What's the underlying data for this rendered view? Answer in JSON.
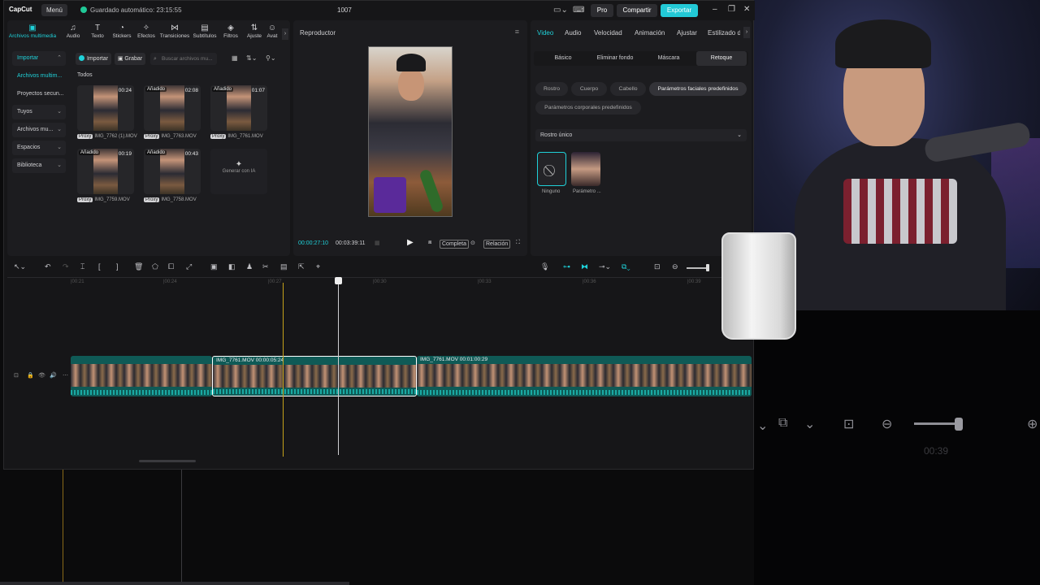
{
  "app": {
    "logo": "CapCut",
    "menu_label": "Menú",
    "autosave": "Guardado automático: 23:15:55",
    "project_title": "1007",
    "pro_label": "Pro",
    "share_label": "Compartir",
    "export_label": "Exportar"
  },
  "media": {
    "tabs": [
      {
        "label": "Archivos multimedia",
        "icon": "media-icon"
      },
      {
        "label": "Audio",
        "icon": "audio-icon"
      },
      {
        "label": "Texto",
        "icon": "text-icon"
      },
      {
        "label": "Stickers",
        "icon": "sticker-icon"
      },
      {
        "label": "Efectos",
        "icon": "effects-icon"
      },
      {
        "label": "Transiciones",
        "icon": "transitions-icon"
      },
      {
        "label": "Subtítulos",
        "icon": "captions-icon"
      },
      {
        "label": "Filtros",
        "icon": "filters-icon"
      },
      {
        "label": "Ajuste",
        "icon": "adjust-icon"
      },
      {
        "label": "Avat",
        "icon": "avatar-icon"
      }
    ],
    "sidebar": [
      {
        "label": "Importar"
      },
      {
        "label": "Archivos multim..."
      },
      {
        "label": "Proyectos secun..."
      },
      {
        "label": "Tuyos"
      },
      {
        "label": "Archivos mu..."
      },
      {
        "label": "Espacios"
      },
      {
        "label": "Biblioteca"
      }
    ],
    "import_label": "Importar",
    "record_label": "Grabar",
    "search_placeholder": "Buscar archivos mu...",
    "section_all": "Todos",
    "proxy_label": "Proxy",
    "added_label": "Añadido",
    "thumbs": [
      {
        "name": "IMG_7762 (1).MOV",
        "duration": "00:24",
        "added": false
      },
      {
        "name": "IMG_7763.MOV",
        "duration": "02:08",
        "added": true
      },
      {
        "name": "IMG_7761.MOV",
        "duration": "01:07",
        "added": true
      },
      {
        "name": "IMG_7759.MOV",
        "duration": "00:19",
        "added": true
      },
      {
        "name": "IMG_7758.MOV",
        "duration": "00:43",
        "added": true
      }
    ],
    "generate_ai": "Generar con IA"
  },
  "player": {
    "title": "Reproductor",
    "current_time": "00:00:27:10",
    "total_time": "00:03:39:11",
    "full_label": "Completa",
    "ratio_label": "Relación"
  },
  "props": {
    "tabs": [
      "Video",
      "Audio",
      "Velocidad",
      "Animación",
      "Ajustar",
      "Estilizado d"
    ],
    "subtabs": [
      "Básico",
      "Eliminar fondo",
      "Máscara",
      "Retoque"
    ],
    "chips": [
      "Rostro",
      "Cuerpo",
      "Cabello",
      "Parámetros faciales predefinidos",
      "Parámetros corporales predefinidos"
    ],
    "dropdown_value": "Rostro único",
    "presets": [
      "Ninguno",
      "Parámetro ..."
    ]
  },
  "timeline": {
    "ruler": [
      "|00:21",
      "|00:24",
      "|00:27",
      "|00:30",
      "|00:33",
      "|00:36",
      "|00:39"
    ],
    "clips": [
      {
        "label": ""
      },
      {
        "label": "IMG_7761.MOV   00:00:05:24"
      },
      {
        "label": "IMG_7761.MOV   00:01:00:29"
      }
    ]
  },
  "ghost": {
    "time": "00:39"
  },
  "colors": {
    "accent": "#1fd1d9",
    "clip": "#0f5a56",
    "marker": "#c6a21a"
  }
}
